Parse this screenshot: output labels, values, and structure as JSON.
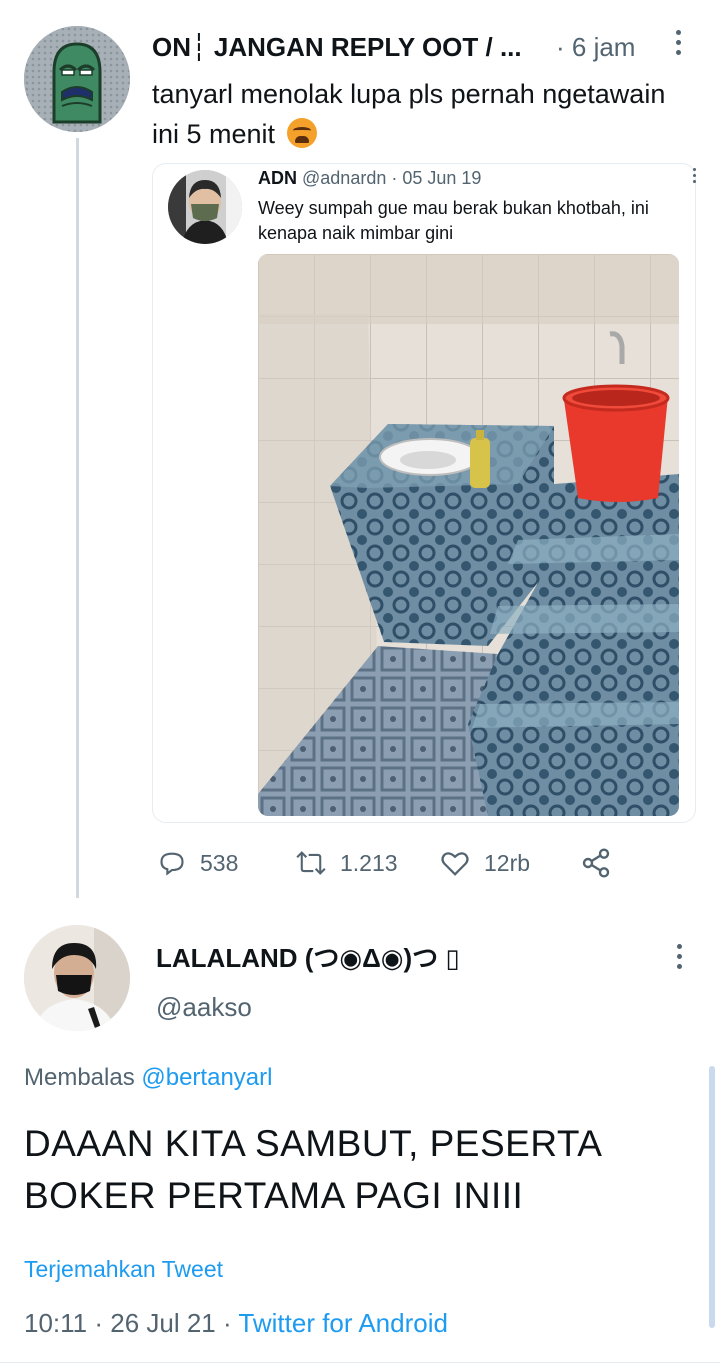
{
  "tweet1": {
    "display_name": "ON┆ JANGAN REPLY OOT / ...",
    "time": "· 6 jam",
    "text": "tanyarl menolak lupa pls pernah ngetawain ini 5 menit",
    "emoji": "tired-face-emoji"
  },
  "quoted": {
    "name": "ADN",
    "meta": "@adnardn · 05 Jun 19",
    "text": "Weey sumpah gue mau berak bukan khotbah, ini kenapa naik mimbar gini",
    "photo": "raised-tiled-squat-toilet-photo"
  },
  "actions": {
    "replies": "538",
    "retweets": "1.213",
    "likes": "12rb"
  },
  "tweet2": {
    "display_name": "LALALAND (つ◉Δ◉)つ ▯",
    "handle": "@aakso",
    "reply_label": "Membalas ",
    "reply_mention": "@bertanyarl",
    "text": "DAAAN KITA SAMBUT, PESERTA BOKER PERTAMA PAGI INIII",
    "translate": "Terjemahkan Tweet",
    "timestamp": "10:11 · 26 Jul 21 · ",
    "source": "Twitter for Android"
  },
  "colors": {
    "accent": "#1d9bf0",
    "muted": "#536471",
    "text": "#0f1419"
  }
}
